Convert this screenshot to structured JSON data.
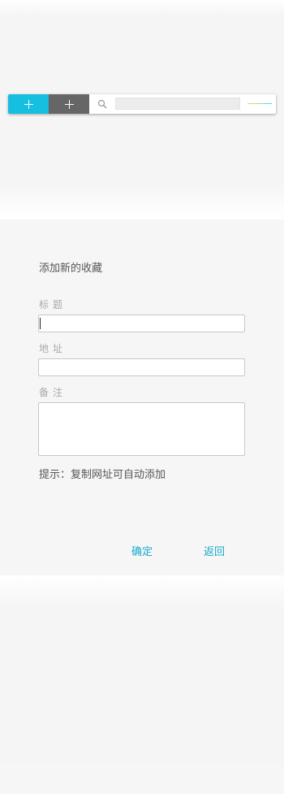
{
  "toolbar": {
    "add_primary_icon": "plus-icon",
    "add_secondary_icon": "plus-icon",
    "search_icon": "search-icon",
    "search_value": "",
    "colors": {
      "primary_button": "#16bfe0",
      "secondary_button": "#666666"
    }
  },
  "form": {
    "title": "添加新的收藏",
    "fields": {
      "title_label": "标题",
      "title_value": "",
      "address_label": "地址",
      "address_value": "",
      "note_label": "备注",
      "note_value": ""
    },
    "hint": "提示：复制网址可自动添加"
  },
  "actions": {
    "confirm": "确定",
    "back": "返回",
    "link_color": "#17a9cc"
  }
}
